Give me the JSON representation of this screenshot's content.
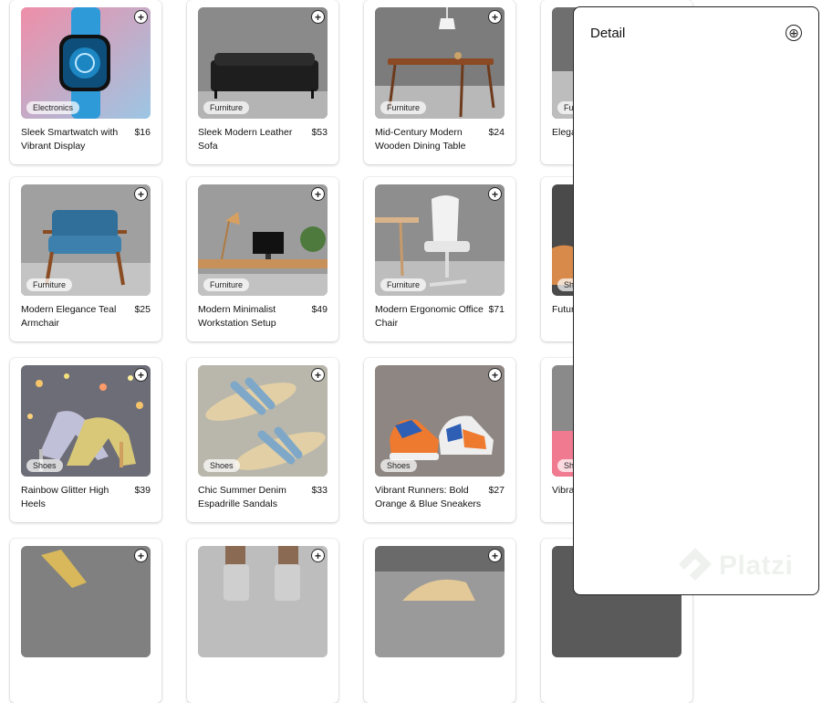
{
  "products": [
    {
      "title": "Sleek Smartwatch with Vibrant Display",
      "price": "$16",
      "category": "Electronics"
    },
    {
      "title": "Sleek Modern Leather Sofa",
      "price": "$53",
      "category": "Furniture"
    },
    {
      "title": "Mid-Century Modern Wooden Dining Table",
      "price": "$24",
      "category": "Furniture"
    },
    {
      "title": "Elega",
      "price": "",
      "category": "Fu"
    },
    {
      "title": "Modern Elegance Teal Armchair",
      "price": "$25",
      "category": "Furniture"
    },
    {
      "title": "Modern Minimalist Workstation Setup",
      "price": "$49",
      "category": "Furniture"
    },
    {
      "title": "Modern Ergonomic Office Chair",
      "price": "$71",
      "category": "Furniture"
    },
    {
      "title": "Futur Socce",
      "price": "",
      "category": "Sh"
    },
    {
      "title": "Rainbow Glitter High Heels",
      "price": "$39",
      "category": "Shoes"
    },
    {
      "title": "Chic Summer Denim Espadrille Sandals",
      "price": "$33",
      "category": "Shoes"
    },
    {
      "title": "Vibrant Runners: Bold Orange & Blue Sneakers",
      "price": "$27",
      "category": "Shoes"
    },
    {
      "title": "Vibra Sneak",
      "price": "",
      "category": "Sh"
    },
    {
      "title": "",
      "price": "",
      "category": ""
    },
    {
      "title": "",
      "price": "",
      "category": ""
    },
    {
      "title": "",
      "price": "",
      "category": ""
    },
    {
      "title": "",
      "price": "",
      "category": ""
    }
  ],
  "detail": {
    "title": "Detail",
    "close_symbol": "⊕"
  },
  "watermark": {
    "text": "Platzi"
  },
  "add_symbol": "+"
}
